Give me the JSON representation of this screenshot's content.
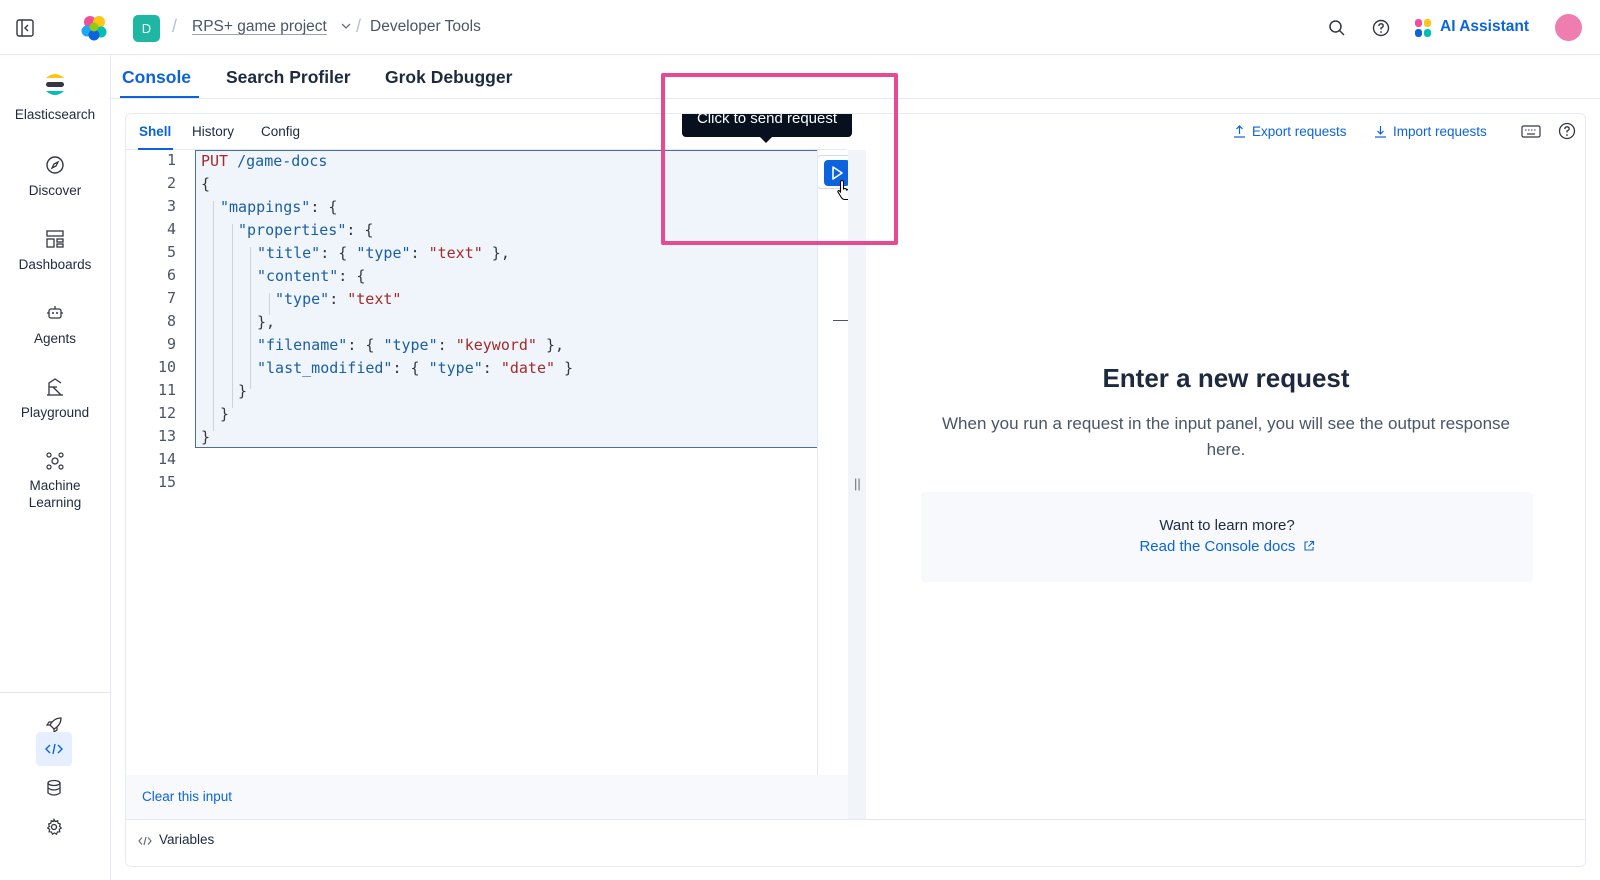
{
  "header": {
    "space_initial": "D",
    "project": "RPS+ game project",
    "breadcrumb": "Developer Tools",
    "ai_assistant": "AI Assistant",
    "colors": {
      "accent": "#0b64dd",
      "space_badge": "#1eb7a3",
      "avatar": "#ef7db0"
    }
  },
  "sidenav": {
    "brand": "Elasticsearch",
    "items": [
      {
        "label": "Discover",
        "icon": "compass-icon"
      },
      {
        "label": "Dashboards",
        "icon": "dashboard-icon"
      },
      {
        "label": "Agents",
        "icon": "robot-icon"
      },
      {
        "label": "Playground",
        "icon": "playground-icon"
      },
      {
        "label": "Machine Learning",
        "icon": "machine-learning-icon"
      }
    ],
    "bottom_icons": [
      "rocket-icon",
      "code-icon",
      "database-icon",
      "gear-icon"
    ]
  },
  "tabs": [
    {
      "label": "Console",
      "active": true
    },
    {
      "label": "Search Profiler",
      "active": false
    },
    {
      "label": "Grok Debugger",
      "active": false
    }
  ],
  "console": {
    "subtabs": [
      "Shell",
      "History",
      "Config"
    ],
    "export_label": "Export requests",
    "import_label": "Import requests",
    "tooltip": "Click to send request",
    "clear_label": "Clear this input",
    "variables_label": "Variables",
    "line_numbers": [
      "1",
      "2",
      "3",
      "4",
      "5",
      "6",
      "7",
      "8",
      "9",
      "10",
      "11",
      "12",
      "13",
      "14",
      "15"
    ],
    "code": {
      "method": "PUT",
      "path": "/game-docs",
      "mappings_key": "\"mappings\"",
      "properties_key": "\"properties\"",
      "title_key": "\"title\"",
      "content_key": "\"content\"",
      "filename_key": "\"filename\"",
      "last_modified_key": "\"last_modified\"",
      "type_key": "\"type\"",
      "text_val": "\"text\"",
      "keyword_val": "\"keyword\"",
      "date_val": "\"date\""
    }
  },
  "output": {
    "title": "Enter a new request",
    "body": "When you run a request in the input panel, you will see the output response here.",
    "learn_title": "Want to learn more?",
    "learn_link": "Read the Console docs"
  }
}
